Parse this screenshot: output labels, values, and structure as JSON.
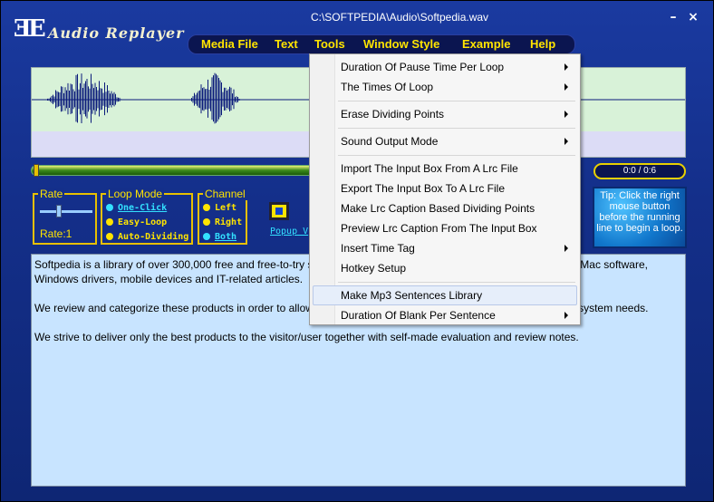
{
  "window": {
    "path": "C:\\SOFTPEDIA\\Audio\\Softpedia.wav",
    "app_name": "Audio Replayer",
    "logo": "ƎE",
    "minimize": "–",
    "close": "×"
  },
  "menu": [
    "Media File",
    "Text",
    "Tools",
    "Window Style",
    "Example",
    "Help"
  ],
  "time": "0:0 / 0:6",
  "rate": {
    "label": "Rate",
    "value": "Rate:1"
  },
  "loop_mode": {
    "label": "Loop Mode",
    "options": [
      "One-Click",
      "Easy-Loop",
      "Auto-Dividing"
    ],
    "selected": "One-Click"
  },
  "channel": {
    "label": "Channel",
    "options": [
      "Left",
      "Right",
      "Both"
    ],
    "selected": "Both"
  },
  "popup_link": "Popup V",
  "tip": "Tip: Click the right mouse button before the running line to begin a loop.",
  "text": {
    "p1": "Softpedia is a library of over 300,000 free and free-to-try software programs for Windows and Unix/Linux, games, Mac software, Windows drivers, mobile devices and IT-related articles.",
    "p2": "We review and categorize these products in order to allow the visitor/user to find the exact product they and their system needs.",
    "p3": "We strive to deliver only the best products to the visitor/user together with self-made evaluation and review notes."
  },
  "tools_menu": [
    {
      "label": "Duration Of Pause Time  Per Loop",
      "submenu": true
    },
    {
      "label": "The Times Of Loop",
      "submenu": true
    },
    {
      "label": "Erase Dividing Points",
      "submenu": true
    },
    {
      "label": "Sound Output Mode",
      "submenu": true
    },
    {
      "label": "Import The Input Box From A Lrc File",
      "submenu": false
    },
    {
      "label": "Export  The Input Box To A Lrc File",
      "submenu": false
    },
    {
      "label": "Make Lrc Caption Based Dividing Points",
      "submenu": false
    },
    {
      "label": "Preview Lrc Caption From The Input Box",
      "submenu": false
    },
    {
      "label": "Insert Time Tag",
      "submenu": true
    },
    {
      "label": "Hotkey Setup",
      "submenu": false
    },
    {
      "label": "Make Mp3 Sentences Library",
      "submenu": false
    },
    {
      "label": "Duration Of Blank Per Sentence",
      "submenu": true
    }
  ],
  "colors": {
    "accent": "#ffe400",
    "link": "#33e0ff",
    "waveform": "#0a1a7a"
  }
}
